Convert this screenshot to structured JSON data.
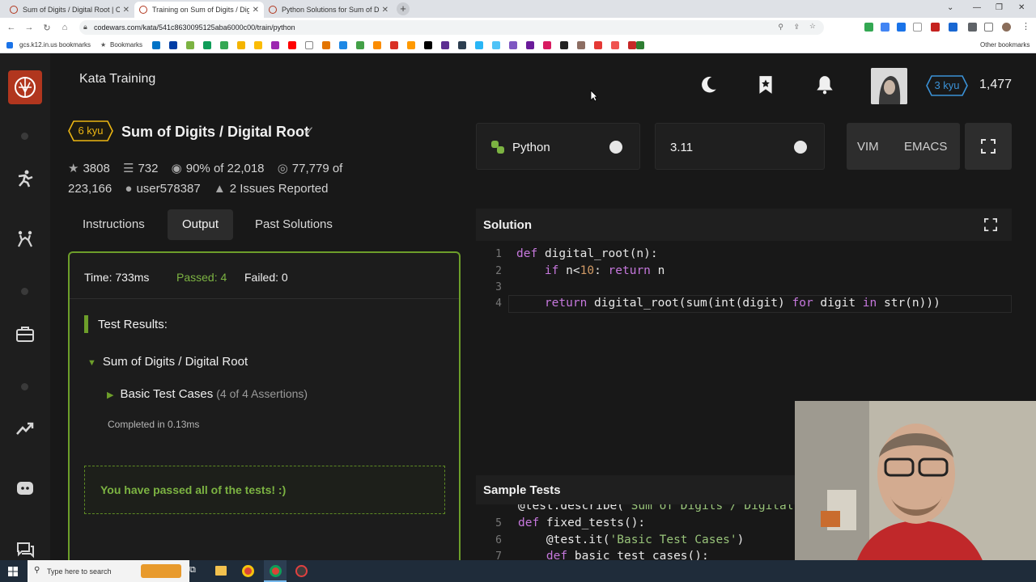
{
  "browser": {
    "tabs": [
      {
        "title": "Sum of Digits / Digital Root | Co"
      },
      {
        "title": "Training on Sum of Digits / Digit"
      },
      {
        "title": "Python Solutions for Sum of Digi"
      }
    ],
    "url": "codewars.com/kata/541c8630095125aba6000c00/train/python",
    "bookmarks": {
      "gcs": "gcs.k12.in.us bookmarks",
      "bookmarks": "Bookmarks",
      "other": "Other bookmarks"
    }
  },
  "header": {
    "page_title": "Kata Training",
    "rank": "3 kyu",
    "honor": "1,477"
  },
  "kata": {
    "rank": "6 kyu",
    "name": "Sum of Digits / Digital Root",
    "stars": "3808",
    "collections": "732",
    "satisfaction": "90%",
    "satisfaction_of": "of 22,018",
    "completed": "77,779",
    "completed_of": "of",
    "total": "223,166",
    "author": "user578387",
    "issues": "2 Issues Reported"
  },
  "tabs": {
    "instructions": "Instructions",
    "output": "Output",
    "past": "Past Solutions"
  },
  "output": {
    "time": "Time: 733ms",
    "passed": "Passed: 4",
    "failed": "Failed: 0",
    "results_title": "Test Results:",
    "suite": "Sum of Digits / Digital Root",
    "group": "Basic Test Cases",
    "assertions": "(4 of 4 Assertions)",
    "completed_in": "Completed in 0.13ms",
    "passed_msg": "You have passed all of the tests! :)"
  },
  "editor": {
    "language": "Python",
    "version": "3.11",
    "keybind_vim": "VIM",
    "keybind_emacs": "EMACS",
    "solution_title": "Solution",
    "line_numbers": [
      "1",
      "2",
      "3",
      "4"
    ],
    "sample_title": "Sample Tests",
    "sample_line_numbers": [
      "5",
      "6",
      "7"
    ]
  },
  "taskbar": {
    "search_placeholder": "Type here to search"
  },
  "colors": {
    "brand": "#b1361e",
    "pass": "#6d9e2a",
    "kyu_yellow": "#ecb613",
    "rank_blue": "#3b91d6"
  }
}
